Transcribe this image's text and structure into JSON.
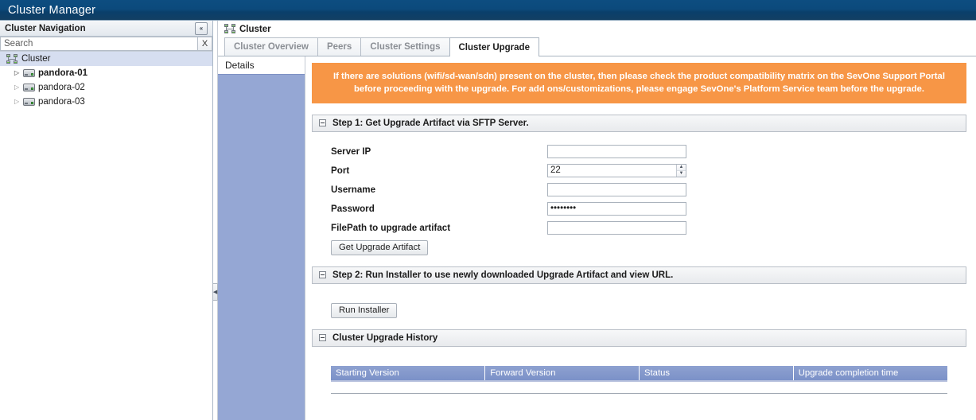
{
  "app": {
    "title": "Cluster Manager"
  },
  "sidebar": {
    "header": "Cluster Navigation",
    "collapse_icon": "collapse-left-icon",
    "collapse_glyph": "«",
    "search": {
      "placeholder": "Search",
      "value": "",
      "clear_label": "X"
    },
    "tree": [
      {
        "label": "Cluster",
        "icon": "cluster-icon",
        "level": 0,
        "bold": false,
        "selected": true,
        "arrow": ""
      },
      {
        "label": "pandora-01",
        "icon": "server-icon",
        "level": 1,
        "bold": true,
        "selected": false,
        "arrow": "▷"
      },
      {
        "label": "pandora-02",
        "icon": "server-icon",
        "level": 1,
        "bold": false,
        "selected": false,
        "arrow": "▷"
      },
      {
        "label": "pandora-03",
        "icon": "server-icon",
        "level": 1,
        "bold": false,
        "selected": false,
        "arrow": "▷"
      }
    ]
  },
  "splitter": {
    "handle_glyph": "◀",
    "handle_icon": "collapse-pane-handle-icon"
  },
  "content": {
    "title": "Cluster",
    "title_icon": "cluster-icon",
    "tabs": [
      {
        "label": "Cluster Overview",
        "active": false
      },
      {
        "label": "Peers",
        "active": false
      },
      {
        "label": "Cluster Settings",
        "active": false
      },
      {
        "label": "Cluster Upgrade",
        "active": true
      }
    ],
    "detail_pane": {
      "tab_label": "Details"
    },
    "banner": {
      "text": "If there are solutions (wifi/sd-wan/sdn) present on the cluster, then please check the product compatibility matrix on the SevOne Support Portal before proceeding with the upgrade. For add ons/customizations, please engage SevOne's Platform Service team before the upgrade.",
      "background": "#f79646",
      "color": "#ffffff"
    },
    "step1": {
      "header": "Step 1: Get Upgrade Artifact via SFTP Server.",
      "toggle_icon": "collapse-minus-icon",
      "fields": [
        {
          "label": "Server IP",
          "value": "",
          "type": "text",
          "name": "server-ip-input"
        },
        {
          "label": "Port",
          "value": "22",
          "type": "spinner",
          "name": "port-input"
        },
        {
          "label": "Username",
          "value": "",
          "type": "text",
          "name": "username-input"
        },
        {
          "label": "Password",
          "value": "••••••••",
          "type": "password",
          "name": "password-input"
        },
        {
          "label": "FilePath to upgrade artifact",
          "value": "",
          "type": "text",
          "name": "filepath-input"
        }
      ],
      "button": "Get Upgrade Artifact",
      "spinner_up": "▲",
      "spinner_down": "▼"
    },
    "step2": {
      "header": "Step 2: Run Installer to use newly downloaded Upgrade Artifact and view URL.",
      "toggle_icon": "collapse-minus-icon",
      "button": "Run Installer"
    },
    "history": {
      "header": "Cluster Upgrade History",
      "toggle_icon": "collapse-minus-icon",
      "columns": [
        "Starting Version",
        "Forward Version",
        "Status",
        "Upgrade completion time"
      ],
      "rows": []
    }
  },
  "colors": {
    "appbar": "#0c4a7c",
    "banner": "#f79646",
    "table_header": "#7b91c8",
    "detail_panel": "#95a7d4",
    "tree_selected": "#d6def0"
  }
}
